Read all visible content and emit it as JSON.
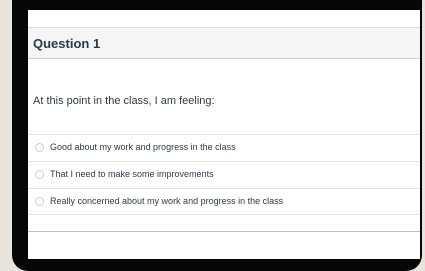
{
  "question": {
    "title": "Question 1",
    "prompt": "At this point in the class, I am feeling:",
    "answers": [
      {
        "label": "Good about my work and progress in the class",
        "selected": false
      },
      {
        "label": "That I need to make some improvements",
        "selected": false
      },
      {
        "label": "Really concerned about my work and progress in the class",
        "selected": false
      }
    ]
  }
}
